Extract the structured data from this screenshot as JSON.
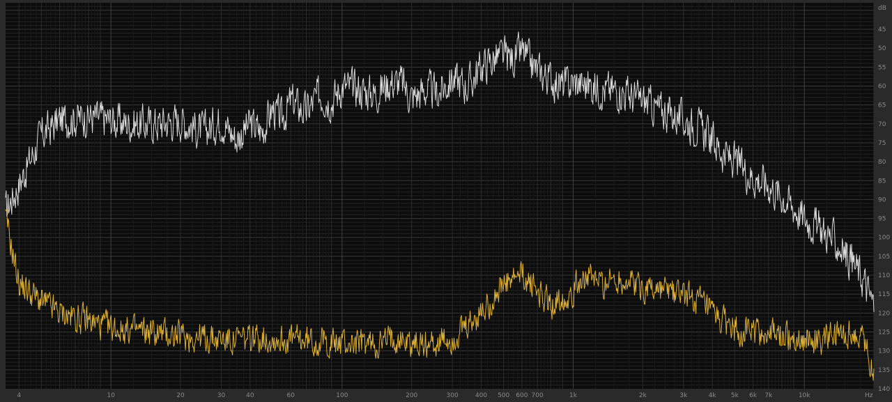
{
  "chart_data": {
    "type": "line",
    "title": "",
    "xlabel": "",
    "ylabel": "",
    "x_unit": "Hz",
    "y_unit": "dB",
    "x_scale": "log",
    "xlim": [
      3.5,
      20000
    ],
    "ylim": [
      -140,
      -38
    ],
    "grid": true,
    "legend": "none",
    "x_tick_labels": [
      "4",
      "10",
      "20",
      "30",
      "40",
      "60",
      "100",
      "200",
      "300",
      "400",
      "500",
      "600",
      "700",
      "1k",
      "2k",
      "3k",
      "4k",
      "5k",
      "6k",
      "7k",
      "10k",
      "Hz"
    ],
    "y_tick_labels": [
      "dB",
      "45",
      "50",
      "55",
      "60",
      "65",
      "70",
      "75",
      "80",
      "85",
      "90",
      "95",
      "100",
      "105",
      "110",
      "115",
      "120",
      "125",
      "130",
      "135",
      "140"
    ],
    "colors": {
      "background": "#0c0c0c",
      "frame": "#2a2a2a",
      "grid_major": "#3a3a3a",
      "grid_minor": "#222222",
      "series_1": "#e6e6e6",
      "series_2": "#e8b838"
    },
    "series": [
      {
        "color": "#e6e6e6",
        "x": [
          3.5,
          4,
          5,
          6,
          8,
          10,
          12,
          15,
          20,
          25,
          30,
          35,
          40,
          45,
          50,
          55,
          60,
          70,
          80,
          90,
          100,
          120,
          140,
          160,
          180,
          200,
          230,
          260,
          300,
          350,
          400,
          450,
          500,
          550,
          600,
          650,
          700,
          800,
          900,
          1000,
          1200,
          1400,
          1600,
          1800,
          2000,
          2300,
          2600,
          3000,
          3500,
          4000,
          4500,
          5000,
          6000,
          7000,
          8000,
          9000,
          10000,
          12000,
          14000,
          16000,
          18000,
          20000
        ],
        "y": [
          -93,
          -86,
          -73,
          -69,
          -68,
          -69,
          -70,
          -70,
          -69,
          -72,
          -69,
          -74,
          -70,
          -72,
          -66,
          -69,
          -64,
          -67,
          -62,
          -64,
          -60,
          -61,
          -62,
          -59,
          -59,
          -63,
          -61,
          -62,
          -58,
          -60,
          -55,
          -53,
          -52,
          -53,
          -51,
          -54,
          -56,
          -58,
          -60,
          -59,
          -60,
          -61,
          -61,
          -63,
          -64,
          -66,
          -67,
          -69,
          -71,
          -74,
          -78,
          -80,
          -84,
          -86,
          -89,
          -92,
          -95,
          -98,
          -102,
          -106,
          -111,
          -118
        ]
      },
      {
        "color": "#e8b838",
        "x": [
          3.5,
          4,
          5,
          6,
          8,
          10,
          15,
          20,
          30,
          40,
          45,
          50,
          60,
          100,
          150,
          170,
          200,
          260,
          300,
          350,
          400,
          450,
          500,
          600,
          700,
          800,
          1000,
          1100,
          1300,
          1600,
          2000,
          2500,
          3000,
          3500,
          4000,
          5000,
          6000,
          8000,
          10000,
          12000,
          15000,
          18000,
          20000
        ],
        "y": [
          -95,
          -112,
          -117,
          -120,
          -122,
          -124,
          -125,
          -126,
          -127,
          -127,
          -126,
          -127,
          -127,
          -128,
          -128,
          -126,
          -128,
          -128,
          -127,
          -124,
          -120,
          -116,
          -113,
          -110,
          -114,
          -118,
          -114,
          -110,
          -112,
          -111,
          -113,
          -114,
          -115,
          -117,
          -121,
          -124,
          -125,
          -126,
          -127,
          -127,
          -126,
          -126,
          -137
        ]
      }
    ]
  }
}
